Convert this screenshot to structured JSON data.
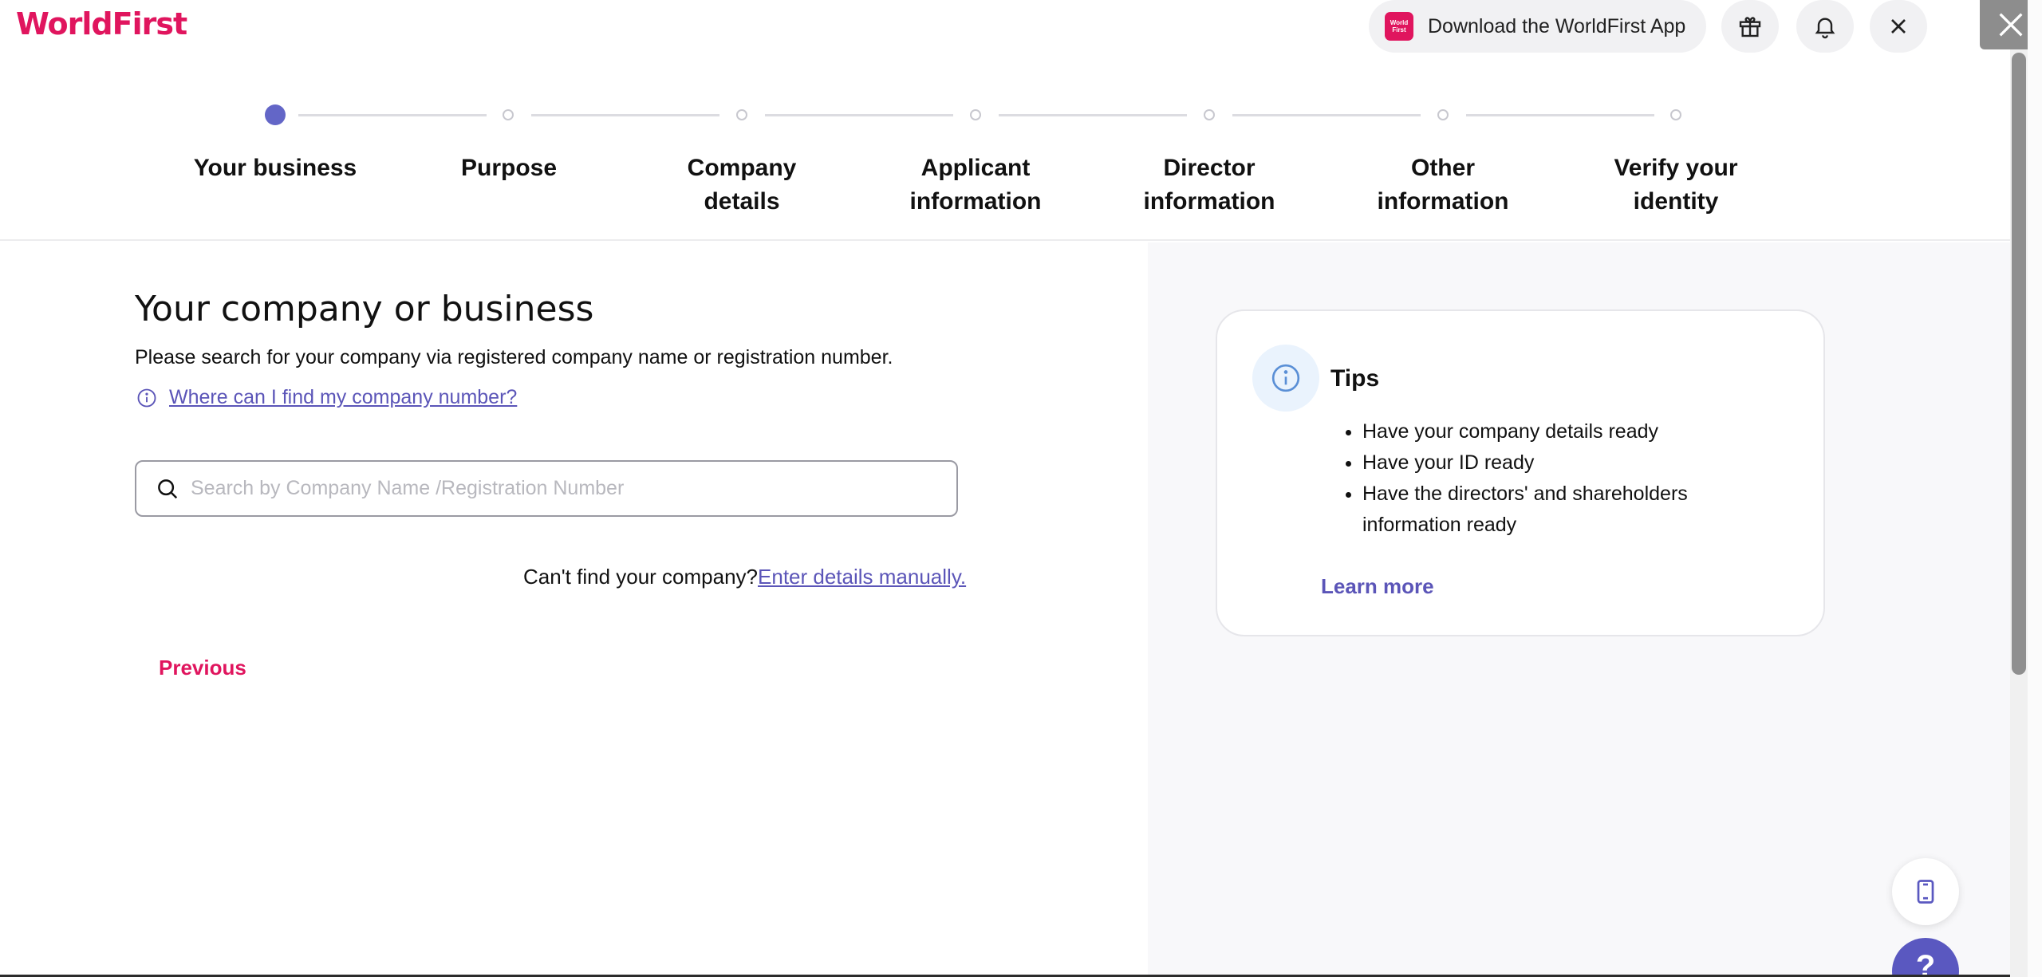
{
  "header": {
    "logo": "WorldFirst",
    "app_button_label": "Download the WorldFirst App",
    "app_icon_text": "World First",
    "icons": [
      "gift-icon",
      "bell-icon",
      "close-icon"
    ]
  },
  "stepper": {
    "active_index": 0,
    "steps": [
      {
        "label_line1": "Your business",
        "label_line2": ""
      },
      {
        "label_line1": "Purpose",
        "label_line2": ""
      },
      {
        "label_line1": "Company details",
        "label_line2": ""
      },
      {
        "label_line1": "Applicant",
        "label_line2": "information"
      },
      {
        "label_line1": "Director",
        "label_line2": "information"
      },
      {
        "label_line1": "Other",
        "label_line2": "information"
      },
      {
        "label_line1": "Verify your",
        "label_line2": "identity"
      }
    ]
  },
  "main": {
    "title": "Your company or business",
    "description": "Please search for your company via registered company name or registration number.",
    "help_link": "Where can I find my company number?",
    "search_placeholder": "Search by Company Name /Registration Number",
    "search_value": "",
    "manual_prompt": "Can't find your company?",
    "manual_link": "Enter details manually.",
    "previous_label": "Previous"
  },
  "tips": {
    "title": "Tips",
    "items": [
      "Have your company details ready",
      "Have your ID ready",
      "Have the directors' and shareholders information ready"
    ],
    "learn_more": "Learn more"
  },
  "floating": {
    "help_label": "?"
  },
  "colors": {
    "brand": "#e0155e",
    "accent": "#6366c7",
    "link": "#5b55b8"
  }
}
